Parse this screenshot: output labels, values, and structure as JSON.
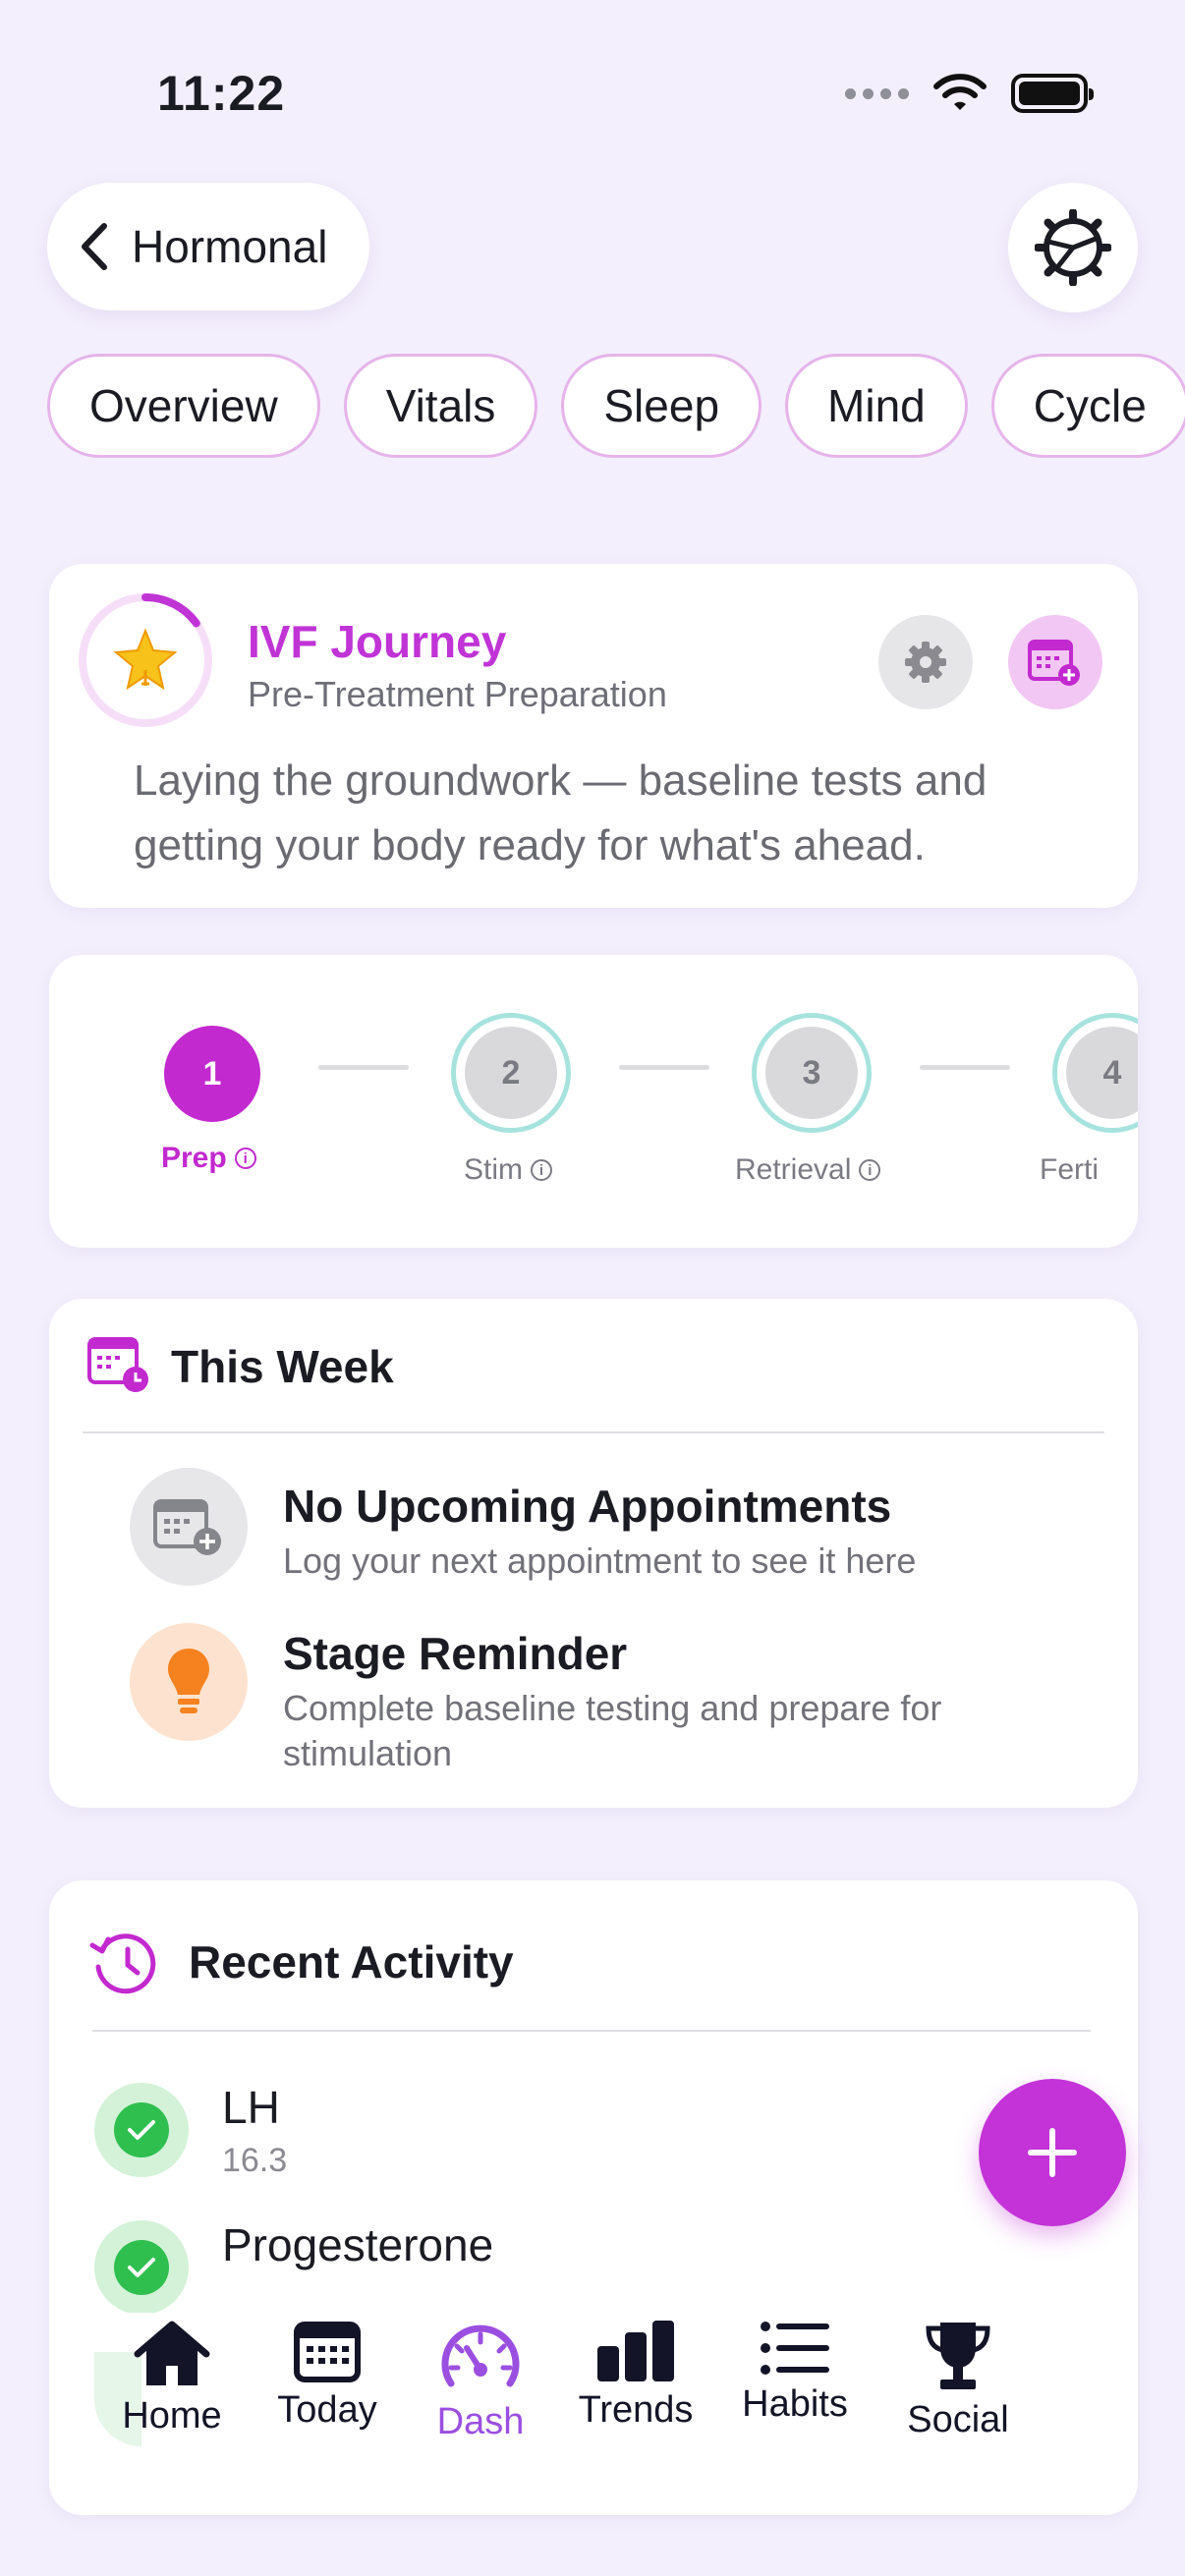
{
  "status_bar": {
    "time": "11:22"
  },
  "header": {
    "back_label": "Hormonal"
  },
  "tabs": [
    {
      "label": "Overview"
    },
    {
      "label": "Vitals"
    },
    {
      "label": "Sleep"
    },
    {
      "label": "Mind"
    },
    {
      "label": "Cycle"
    }
  ],
  "journey": {
    "title": "IVF Journey",
    "subtitle": "Pre-Treatment Preparation",
    "description": "Laying the groundwork — baseline tests and getting your body ready for what's ahead.",
    "progress": 0.15,
    "accent_color": "#c034d6"
  },
  "stages": [
    {
      "number": "1",
      "label": "Prep",
      "active": true
    },
    {
      "number": "2",
      "label": "Stim",
      "active": false
    },
    {
      "number": "3",
      "label": "Retrieval",
      "active": false
    },
    {
      "number": "4",
      "label": "Ferti",
      "active": false
    }
  ],
  "this_week": {
    "title": "This Week",
    "items": [
      {
        "title": "No Upcoming Appointments",
        "subtitle": "Log your next appointment to see it here",
        "icon": "calendar-plus-icon"
      },
      {
        "title": "Stage Reminder",
        "subtitle": "Complete baseline testing and prepare for stimulation",
        "icon": "lightbulb-icon"
      }
    ]
  },
  "recent_activity": {
    "title": "Recent Activity",
    "items": [
      {
        "name": "LH",
        "value": "16.3"
      },
      {
        "name": "Progesterone",
        "value": ""
      }
    ]
  },
  "bottom_nav": [
    {
      "label": "Home",
      "icon": "home-icon"
    },
    {
      "label": "Today",
      "icon": "calendar-icon"
    },
    {
      "label": "Dash",
      "icon": "gauge-icon",
      "active": true
    },
    {
      "label": "Trends",
      "icon": "bar-chart-icon"
    },
    {
      "label": "Habits",
      "icon": "list-icon"
    },
    {
      "label": "Social",
      "icon": "trophy-icon"
    }
  ],
  "colors": {
    "background": "#f3effc",
    "primary": "#c229cf",
    "nav_active": "#9b4fe0",
    "check_green": "#2fbf4f"
  }
}
